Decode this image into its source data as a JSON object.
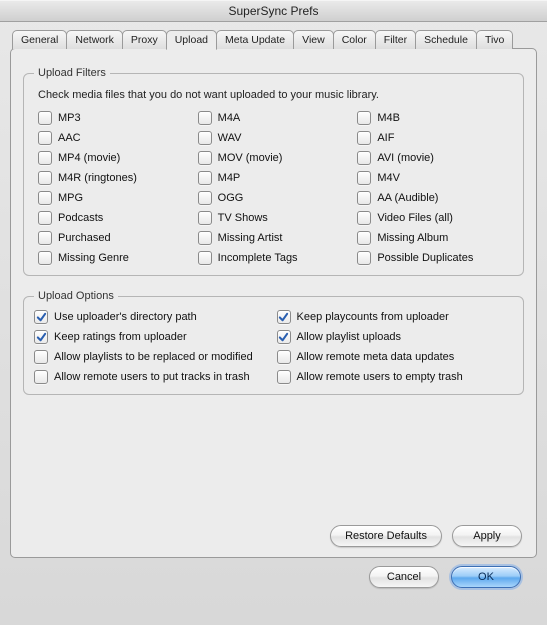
{
  "window": {
    "title": "SuperSync Prefs"
  },
  "tabs": [
    {
      "label": "General"
    },
    {
      "label": "Network"
    },
    {
      "label": "Proxy"
    },
    {
      "label": "Upload",
      "active": true
    },
    {
      "label": "Meta Update"
    },
    {
      "label": "View"
    },
    {
      "label": "Color"
    },
    {
      "label": "Filter"
    },
    {
      "label": "Schedule"
    },
    {
      "label": "Tivo"
    }
  ],
  "filters": {
    "legend": "Upload Filters",
    "hint": "Check media files that you do not want uploaded to your music library.",
    "items": [
      {
        "label": "MP3",
        "checked": false
      },
      {
        "label": "M4A",
        "checked": false
      },
      {
        "label": "M4B",
        "checked": false
      },
      {
        "label": "AAC",
        "checked": false
      },
      {
        "label": "WAV",
        "checked": false
      },
      {
        "label": "AIF",
        "checked": false
      },
      {
        "label": "MP4 (movie)",
        "checked": false
      },
      {
        "label": "MOV (movie)",
        "checked": false
      },
      {
        "label": "AVI (movie)",
        "checked": false
      },
      {
        "label": "M4R (ringtones)",
        "checked": false
      },
      {
        "label": "M4P",
        "checked": false
      },
      {
        "label": "M4V",
        "checked": false
      },
      {
        "label": "MPG",
        "checked": false
      },
      {
        "label": "OGG",
        "checked": false
      },
      {
        "label": "AA (Audible)",
        "checked": false
      },
      {
        "label": "Podcasts",
        "checked": false
      },
      {
        "label": "TV Shows",
        "checked": false
      },
      {
        "label": "Video Files (all)",
        "checked": false
      },
      {
        "label": "Purchased",
        "checked": false
      },
      {
        "label": "Missing Artist",
        "checked": false
      },
      {
        "label": "Missing Album",
        "checked": false
      },
      {
        "label": "Missing Genre",
        "checked": false
      },
      {
        "label": "Incomplete Tags",
        "checked": false
      },
      {
        "label": "Possible Duplicates",
        "checked": false
      }
    ]
  },
  "options": {
    "legend": "Upload Options",
    "items": [
      {
        "label": "Use uploader's directory path",
        "checked": true
      },
      {
        "label": "Keep playcounts from uploader",
        "checked": true
      },
      {
        "label": "Keep ratings from uploader",
        "checked": true
      },
      {
        "label": "Allow playlist uploads",
        "checked": true
      },
      {
        "label": "Allow playlists to be replaced or modified",
        "checked": false
      },
      {
        "label": "Allow remote meta data updates",
        "checked": false
      },
      {
        "label": "Allow remote users to put tracks in trash",
        "checked": false
      },
      {
        "label": "Allow remote users to empty trash",
        "checked": false
      }
    ]
  },
  "buttons": {
    "restore": "Restore Defaults",
    "apply": "Apply",
    "cancel": "Cancel",
    "ok": "OK"
  }
}
